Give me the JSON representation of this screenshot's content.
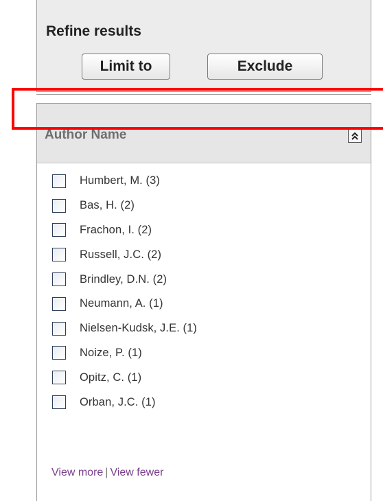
{
  "refine": {
    "title": "Refine results",
    "limit_label": "Limit to",
    "exclude_label": "Exclude"
  },
  "author_facet": {
    "title": "Author Name",
    "collapse_icon": "collapse-up-double-chevron",
    "items": [
      {
        "label": "Humbert, M. (3)"
      },
      {
        "label": "Bas, H. (2)"
      },
      {
        "label": "Frachon, I. (2)"
      },
      {
        "label": "Russell, J.C. (2)"
      },
      {
        "label": "Brindley, D.N. (2)"
      },
      {
        "label": "Neumann, A. (1)"
      },
      {
        "label": "Nielsen-Kudsk, J.E. (1)"
      },
      {
        "label": "Noize, P. (1)"
      },
      {
        "label": "Opitz, C. (1)"
      },
      {
        "label": "Orban, J.C. (1)"
      }
    ],
    "view_more": "View more",
    "separator": "|",
    "view_fewer": "View fewer"
  },
  "colors": {
    "highlight": "#ff0000",
    "link": "#7a3f8c",
    "header_bg": "#e6e6e6"
  }
}
